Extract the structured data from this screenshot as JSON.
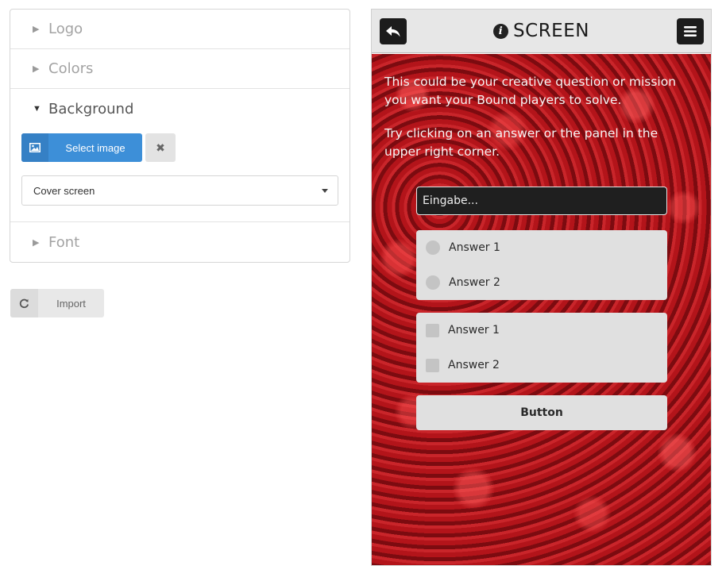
{
  "sidebar": {
    "sections": [
      {
        "label": "Logo"
      },
      {
        "label": "Colors"
      },
      {
        "label": "Background"
      },
      {
        "label": "Font"
      }
    ],
    "background": {
      "select_image_label": "Select image",
      "fit_mode": "Cover screen"
    },
    "import_label": "Import"
  },
  "preview": {
    "header_title": "SCREEN",
    "mission_paragraphs": [
      "This could be your creative question or mission you want your Bound players to solve.",
      "Try clicking on an answer or the panel in the upper right corner."
    ],
    "input_placeholder": "Eingabe...",
    "radio_answers": [
      "Answer 1",
      "Answer 2"
    ],
    "checkbox_answers": [
      "Answer 1",
      "Answer 2"
    ],
    "button_label": "Button"
  },
  "colors": {
    "accent": "#3d8fd8",
    "header_bg": "#e7e7e7",
    "answer_box_bg": "#e0e0e0"
  }
}
